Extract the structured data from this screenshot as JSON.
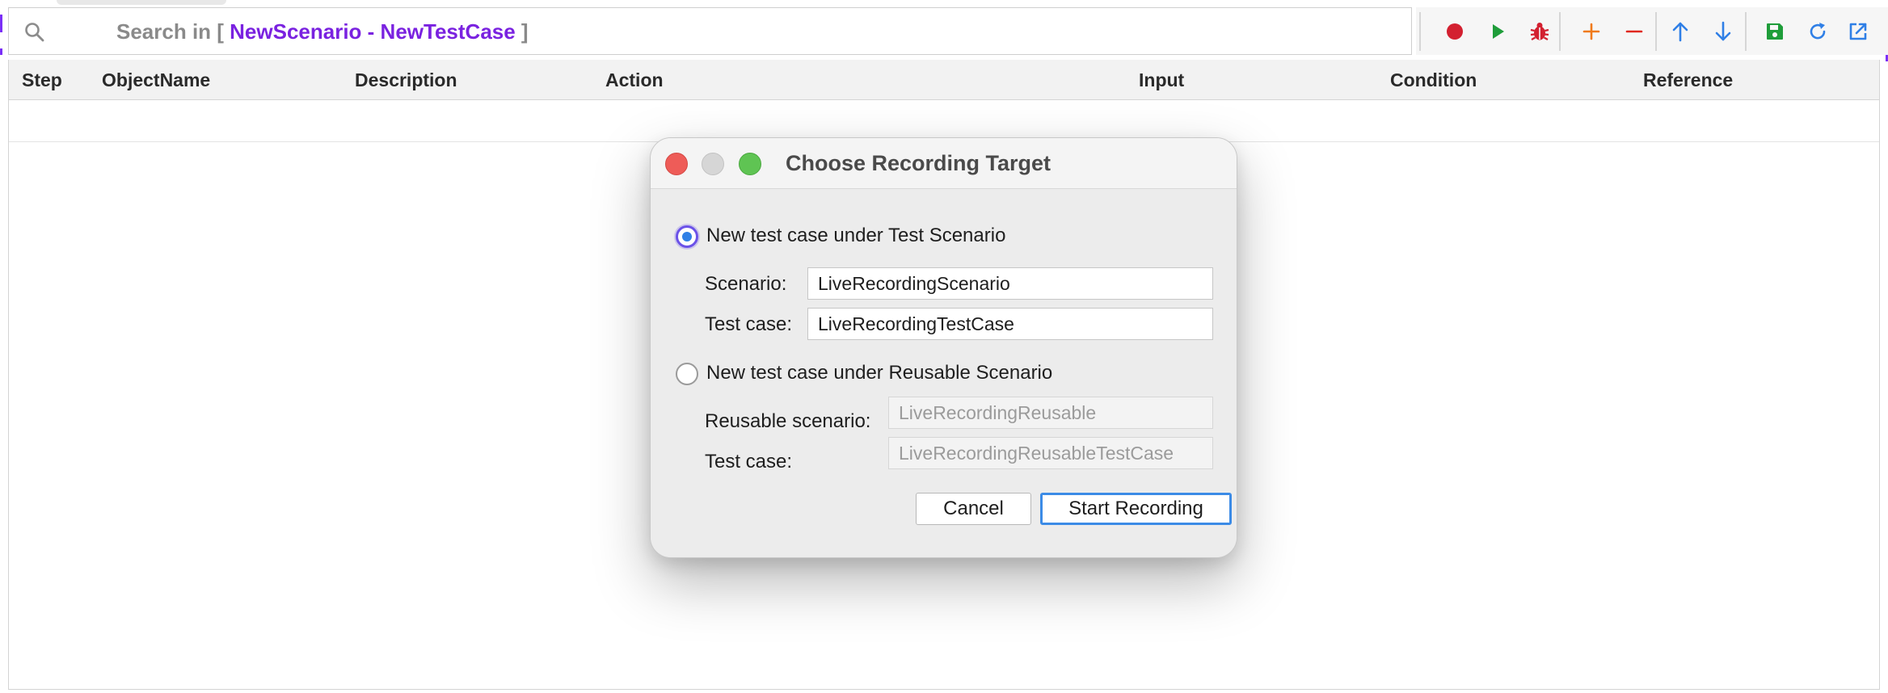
{
  "search": {
    "prefix": "Search in [ ",
    "context": "NewScenario - NewTestCase",
    "suffix": " ]"
  },
  "toolbar": {
    "buttons": [
      {
        "name": "record",
        "icon": "record-icon",
        "color": "#d32030"
      },
      {
        "name": "run",
        "icon": "play-icon",
        "color": "#1f9d3a"
      },
      {
        "name": "debug",
        "icon": "bug-icon",
        "color": "#d32030"
      },
      {
        "name": "add-step",
        "icon": "plus-icon",
        "color": "#f07a1a"
      },
      {
        "name": "remove-step",
        "icon": "minus-icon",
        "color": "#e0281f"
      },
      {
        "name": "move-up",
        "icon": "arrow-up-icon",
        "color": "#2f7fe6"
      },
      {
        "name": "move-down",
        "icon": "arrow-down-icon",
        "color": "#2f7fe6"
      },
      {
        "name": "save",
        "icon": "save-icon",
        "color": "#1f9d3a"
      },
      {
        "name": "reload",
        "icon": "reload-icon",
        "color": "#2f7fe6"
      },
      {
        "name": "open-external",
        "icon": "external-link-icon",
        "color": "#2f7fe6"
      }
    ]
  },
  "table": {
    "columns": [
      "Step",
      "ObjectName",
      "Description",
      "Action",
      "Input",
      "Condition",
      "Reference"
    ]
  },
  "dialog": {
    "title": "Choose Recording Target",
    "option_test_scenario": {
      "label": "New test case under Test Scenario",
      "selected": true,
      "scenario_label": "Scenario:",
      "scenario_value": "LiveRecordingScenario",
      "testcase_label": "Test case:",
      "testcase_value": "LiveRecordingTestCase"
    },
    "option_reusable": {
      "label": "New test case under Reusable Scenario",
      "selected": false,
      "scenario_label": "Reusable scenario:",
      "scenario_value": "LiveRecordingReusable",
      "testcase_label": "Test case:",
      "testcase_value": "LiveRecordingReusableTestCase"
    },
    "cancel_label": "Cancel",
    "start_label": "Start Recording"
  }
}
